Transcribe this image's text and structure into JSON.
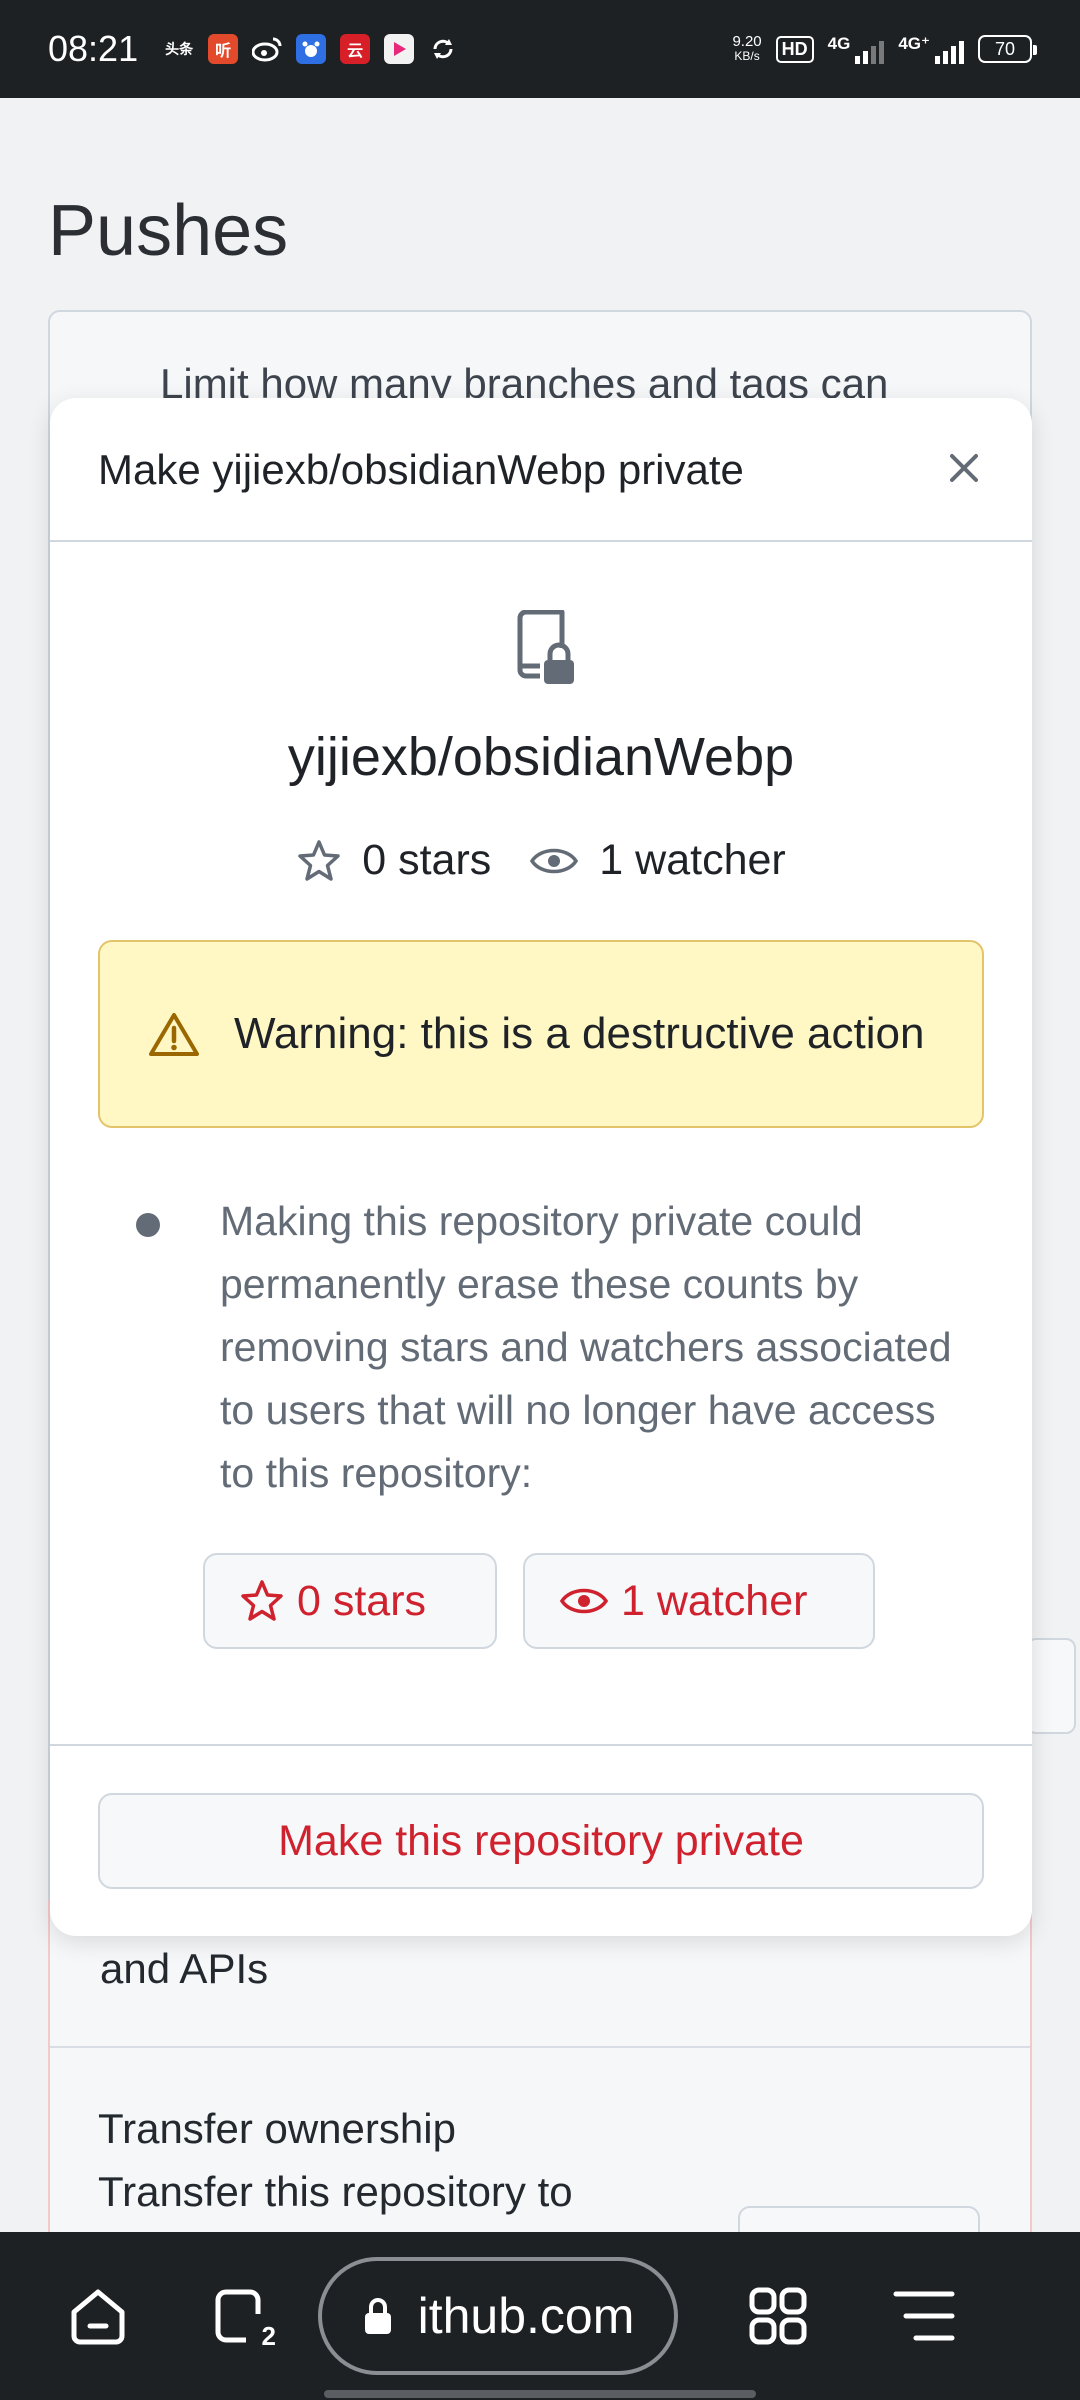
{
  "status_bar": {
    "time": "08:21",
    "app_icons": [
      {
        "name": "toutiao-icon",
        "label": "头条",
        "color": "#1e2124"
      },
      {
        "name": "listen-icon",
        "label": "听",
        "color": "#e34a2b"
      },
      {
        "name": "weibo-icon",
        "label": "",
        "color": "#1e2124"
      },
      {
        "name": "baidu-icon",
        "label": "",
        "color": "#2f6fe4"
      },
      {
        "name": "news-icon",
        "label": "云",
        "color": "#d61f26"
      },
      {
        "name": "video-icon",
        "label": "",
        "color": "#f2f2f2"
      },
      {
        "name": "sync-icon",
        "label": "",
        "color": "#1e2124"
      }
    ],
    "net_speed_value": "9.20",
    "net_speed_unit": "KB/s",
    "hd": "HD",
    "sim1": "4G",
    "sim2": "4G⁺",
    "battery": "70"
  },
  "background": {
    "page_title": "Pushes",
    "card_text": "Limit how many branches and tags can",
    "dz_text": "and APIs",
    "dz_heading": "Transfer ownership",
    "dz_desc": "Transfer this repository to"
  },
  "modal": {
    "title": "Make yijiexb/obsidianWebp private",
    "repo_name": "yijiexb/obsidianWebp",
    "stars_label": "0 stars",
    "watchers_label": "1 watcher",
    "warning": "Warning: this is a destructive action",
    "bullet": "Making this repository private could permanently erase these counts by removing stars and watchers associated to users that will no longer have access to this repository:",
    "stars_button": "0 stars",
    "watchers_button": "1 watcher",
    "confirm_button": "Make this repository private",
    "colors": {
      "danger": "#cf222e",
      "warning_bg": "#fff8c5",
      "muted": "#636c76"
    }
  },
  "browser": {
    "url": "ithub.com",
    "tab_count": "2"
  }
}
